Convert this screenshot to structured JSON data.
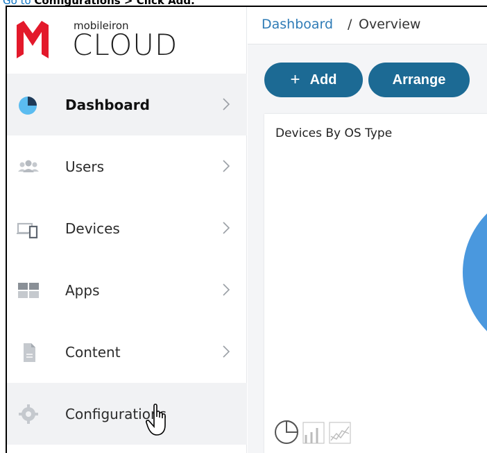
{
  "instruction": {
    "prefix": "Go to ",
    "bold": "Configurations > Click Add."
  },
  "brand": {
    "sub": "mobileiron",
    "main": "CLOUD"
  },
  "nav": [
    {
      "label": "Dashboard",
      "icon": "pie-chart-icon",
      "active": true
    },
    {
      "label": "Users",
      "icon": "users-icon"
    },
    {
      "label": "Devices",
      "icon": "devices-icon"
    },
    {
      "label": "Apps",
      "icon": "apps-grid-icon"
    },
    {
      "label": "Content",
      "icon": "document-icon"
    },
    {
      "label": "Configurations",
      "icon": "gear-icon",
      "hover": true
    }
  ],
  "breadcrumb": {
    "root": "Dashboard",
    "separator": "/",
    "current": "Overview"
  },
  "buttons": {
    "add_symbol": "+",
    "add_label": "Add",
    "arrange_label": "Arrange"
  },
  "card": {
    "title": "Devices By OS Type"
  },
  "colors": {
    "accent": "#1c6a94",
    "link": "#2e7bb6",
    "pie": "#4a98de",
    "brand_red": "#e3192b"
  }
}
